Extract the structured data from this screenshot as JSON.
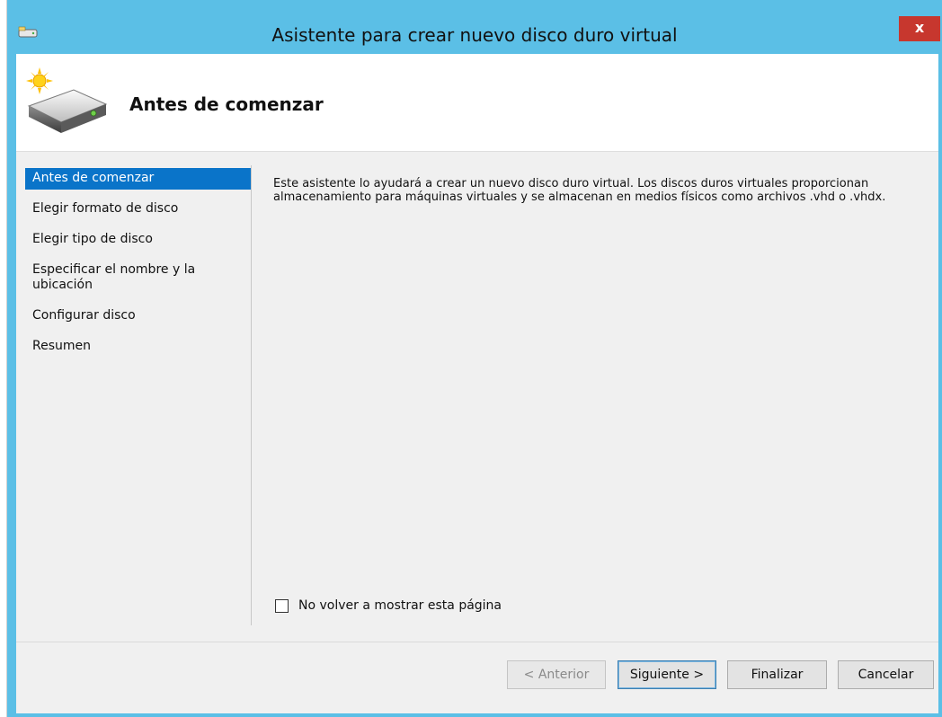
{
  "window": {
    "title": "Asistente para crear nuevo disco duro virtual",
    "close_label": "x",
    "app_icon": "drive-icon"
  },
  "header": {
    "title": "Antes de comenzar",
    "icon": "new-hard-disk-icon"
  },
  "nav": {
    "items": [
      {
        "label": "Antes de comenzar",
        "selected": true
      },
      {
        "label": "Elegir formato de disco",
        "selected": false
      },
      {
        "label": "Elegir tipo de disco",
        "selected": false
      },
      {
        "label": "Especificar el nombre y la ubicación",
        "selected": false
      },
      {
        "label": "Configurar disco",
        "selected": false
      },
      {
        "label": "Resumen",
        "selected": false
      }
    ]
  },
  "content": {
    "description": "Este asistente lo ayudará a crear un nuevo disco duro virtual. Los discos duros virtuales proporcionan almacenamiento para máquinas virtuales y se almacenan en medios físicos como archivos .vhd o .vhdx.",
    "checkbox_label": "No volver a mostrar esta página",
    "checkbox_checked": false
  },
  "buttons": {
    "previous": "< Anterior",
    "next": "Siguiente >",
    "finish": "Finalizar",
    "cancel": "Cancelar"
  },
  "colors": {
    "titlebar": "#5bbfe6",
    "selection": "#0a74c9",
    "close": "#c7372e"
  }
}
